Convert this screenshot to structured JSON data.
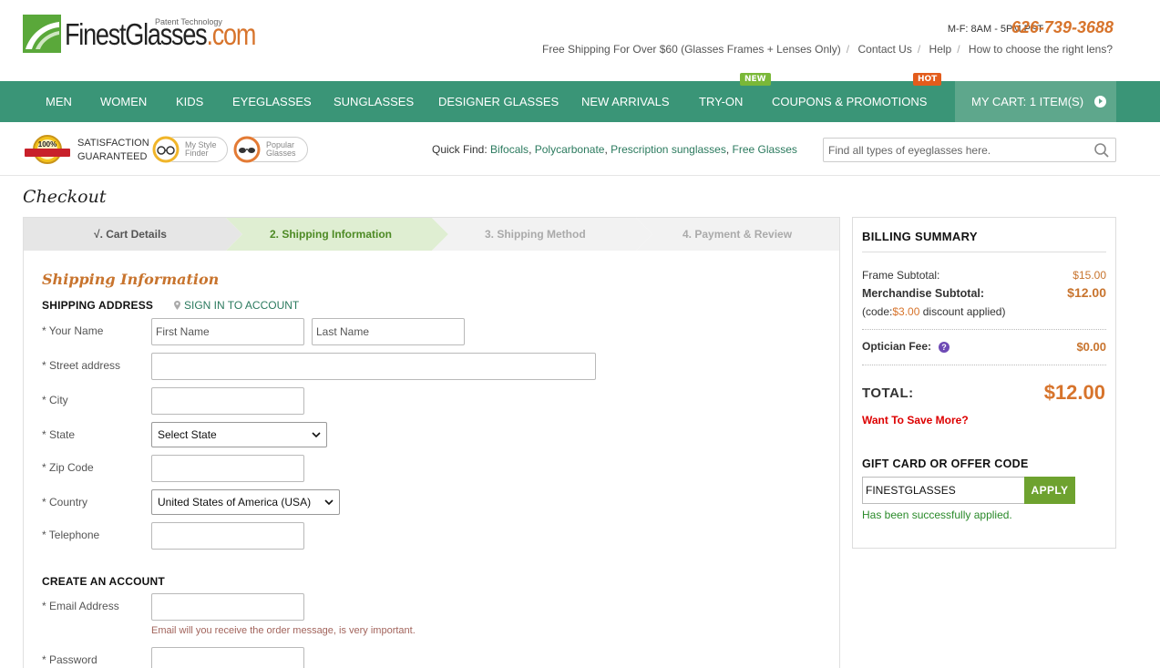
{
  "header": {
    "logo_text": "FinestGlasses",
    "logo_suffix": ".com",
    "tagline": "Patent Technology",
    "hours": "M-F: 8AM - 5PM PST",
    "phone": "626-739-3688",
    "top_links": [
      "Free Shipping For Over $60 (Glasses Frames + Lenses Only)",
      "Contact Us",
      "Help",
      "How to choose the right lens?"
    ]
  },
  "nav": {
    "items": [
      "MEN",
      "WOMEN",
      "KIDS",
      "EYEGLASSES",
      "SUNGLASSES",
      "DESIGNER GLASSES",
      "NEW ARRIVALS",
      "TRY-ON",
      "COUPONS & PROMOTIONS"
    ],
    "badge_new": "NEW",
    "badge_hot": "HOT",
    "cart": "MY CART: 1 ITEM(S)"
  },
  "subbar": {
    "seal_pct": "100%",
    "satisfaction_line1": "SATISFACTION",
    "satisfaction_line2": "GUARANTEED",
    "style_finder_1": "My Style",
    "style_finder_2": "Finder",
    "popular_1": "Popular",
    "popular_2": "Glasses",
    "quick_find_label": "Quick Find:",
    "quick_links": [
      "Bifocals",
      "Polycarbonate",
      "Prescription sunglasses",
      "Free Glasses"
    ],
    "search_placeholder": "Find all types of eyeglasses here."
  },
  "page_title": "Checkout",
  "steps": [
    "√. Cart Details",
    "2. Shipping Information",
    "3. Shipping Method",
    "4. Payment & Review"
  ],
  "form": {
    "section_title": "Shipping Information",
    "shipping_address": "SHIPPING ADDRESS",
    "sign_in": "SIGN IN TO ACCOUNT",
    "labels": {
      "name": "* Your Name",
      "street": "* Street address",
      "city": "* City",
      "state": "* State",
      "zip": "* Zip Code",
      "country": "* Country",
      "telephone": "* Telephone",
      "email": "* Email Address",
      "password": "* Password"
    },
    "first_name_placeholder": "First Name",
    "last_name_placeholder": "Last Name",
    "state_value": "Select State",
    "country_value": "United States of America (USA)",
    "create_account": "CREATE AN ACCOUNT",
    "email_hint": "Email will you receive the order message, is very important."
  },
  "billing": {
    "title": "BILLING SUMMARY",
    "frame_subtotal_label": "Frame Subtotal:",
    "frame_subtotal": "$15.00",
    "merch_subtotal_label": "Merchandise Subtotal:",
    "merch_subtotal": "$12.00",
    "discount_pre": "(code:",
    "discount_amount": "$3.00",
    "discount_post": " discount applied)",
    "optician_label": "Optician Fee:",
    "optician_fee": "$0.00",
    "total_label": "TOTAL:",
    "total": "$12.00",
    "save_more": "Want To Save More?",
    "code_title": "GIFT CARD OR OFFER CODE",
    "code_value": "FINESTGLASSES",
    "apply": "APPLY",
    "applied_msg": "Has been successfully applied."
  },
  "colors": {
    "nav_green": "#3a9577",
    "accent_orange": "#d7742c",
    "link_green": "#2b7a5e",
    "apply_green": "#6ea22f"
  }
}
